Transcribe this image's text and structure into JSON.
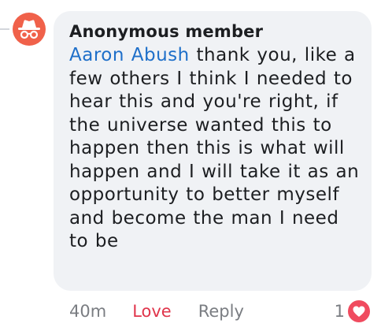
{
  "comment": {
    "author": "Anonymous member",
    "mention": "Aaron Abush",
    "text": " thank you, like a few others I think I needed to hear this and you're right, if the universe wanted this to happen then this is what will happen and I will take it as an opportunity to better myself and become the man I need to be"
  },
  "actions": {
    "time": "40m",
    "love_label": "Love",
    "reply_label": "Reply"
  },
  "reactions": {
    "count": "1",
    "icon": "heart-icon"
  },
  "colors": {
    "avatar_bg": "#f0614a",
    "bubble_bg": "#f0f2f5",
    "mention": "#1e6fc9",
    "love": "#e0354b"
  }
}
